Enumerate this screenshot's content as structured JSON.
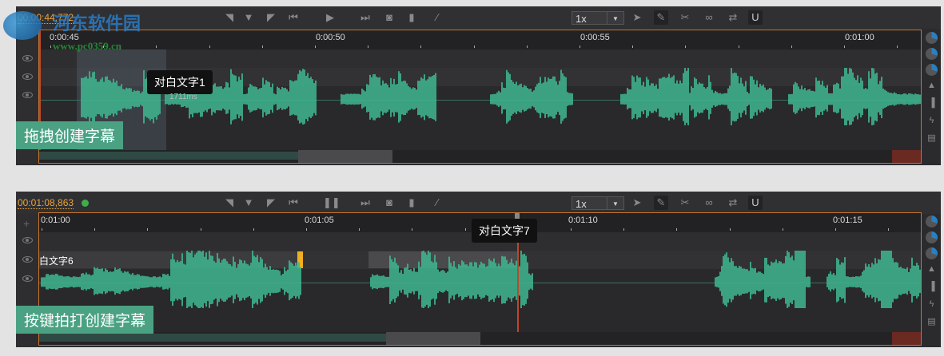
{
  "watermark": {
    "name": "河东软件园",
    "url": "www.pc0359.cn"
  },
  "colors": {
    "accent": "#e8a33a",
    "waveform": "#3fb68f",
    "playhead": "#c0452a",
    "caption_bg": "#4aa283"
  },
  "toolbar_icons": [
    "mark-in-icon",
    "mark-center-icon",
    "mark-out-icon",
    "skip-back-icon",
    "play-pause-icon",
    "skip-forward-icon",
    "camera-icon",
    "bookmark-icon",
    "magic-wand-icon"
  ],
  "tool_icons": [
    "pointer-icon",
    "edit-icon",
    "scissors-icon",
    "link-icon",
    "swap-icon",
    "magnet-icon"
  ],
  "right_icons": [
    "volume-knob-icon",
    "volume-knob-icon",
    "volume-knob-icon",
    "waveform-icon",
    "spectrum-icon",
    "lightning-icon",
    "subtitle-list-icon"
  ],
  "panel1": {
    "timecode": "00:00:44,772",
    "play_icon": "play-icon",
    "speed": "1x",
    "ruler": [
      "0:00:45",
      "0:00:50",
      "0:00:55",
      "0:01:00"
    ],
    "tooltip": "对白文字1",
    "duration": "1711ms",
    "caption": "拖拽创建字幕"
  },
  "panel2": {
    "timecode": "00:01:08,863",
    "play_icon": "pause-icon",
    "speed": "1x",
    "ruler": [
      "0:01:00",
      "0:01:05",
      "0:01:10",
      "0:01:15"
    ],
    "subtitle": "白文字6",
    "tooltip": "对白文字7",
    "caption": "按键拍打创建字幕"
  }
}
